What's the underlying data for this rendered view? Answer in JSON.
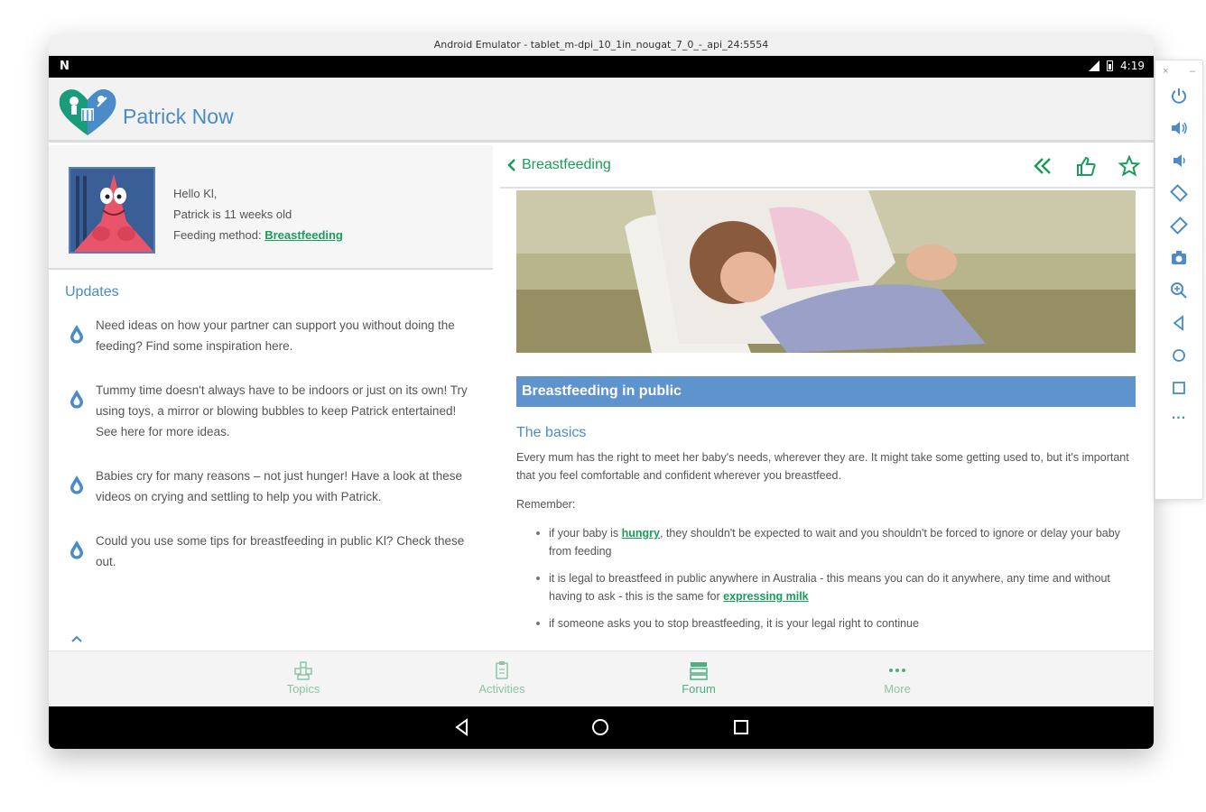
{
  "window": {
    "title": "Android Emulator - tablet_m-dpi_10_1in_nougat_7_0_-_api_24:5554"
  },
  "statusbar": {
    "notif_glyph": "N",
    "time": "4:19"
  },
  "app": {
    "title": "Patrick Now"
  },
  "profile": {
    "greeting": "Hello Kl,",
    "age_line": "Patrick is 11 weeks old",
    "feeding_label": "Feeding method: ",
    "feeding_value": "Breastfeeding"
  },
  "updates": {
    "title": "Updates",
    "items": [
      "Need ideas on how your partner can support you without doing the feeding? Find some inspiration here.",
      "Tummy time doesn't always have to be indoors or just on its own! Try using toys, a mirror or blowing bubbles to keep Patrick entertained! See here for more ideas.",
      "Babies cry for many reasons – not just hunger! Have a look at these videos on crying and settling to help you with Patrick.",
      "Could you use some tips for breastfeeding in public Kl? Check these out."
    ]
  },
  "article": {
    "back_label": "Breastfeeding",
    "section_title": "Breastfeeding in public",
    "subheading": "The basics",
    "intro": "Every mum has the right to meet her baby's needs, wherever they are. It might take some getting used to, but it's important that you feel comfortable and confident wherever you breastfeed.",
    "remember": "Remember:",
    "bullet1_pre": "if your baby is ",
    "bullet1_link": "hungry",
    "bullet1_post": ", they shouldn't be expected to wait and you shouldn't be forced to ignore or delay your baby from feeding",
    "bullet2_pre": "it is legal to breastfeed in public anywhere in Australia - this means you can do it anywhere, any time and without having to ask - this is the same for ",
    "bullet2_link": "expressing milk",
    "bullet3": "if someone asks you to stop breastfeeding, it is your legal right to continue"
  },
  "bottom_nav": {
    "topics": "Topics",
    "activities": "Activities",
    "forum": "Forum",
    "more": "More"
  },
  "side_panel": {
    "close": "×",
    "minimize": "–",
    "more": "..."
  },
  "colors": {
    "accent_blue": "#4a8bc8",
    "accent_green": "#1a9c5a",
    "section_blue": "#5f93cd"
  }
}
